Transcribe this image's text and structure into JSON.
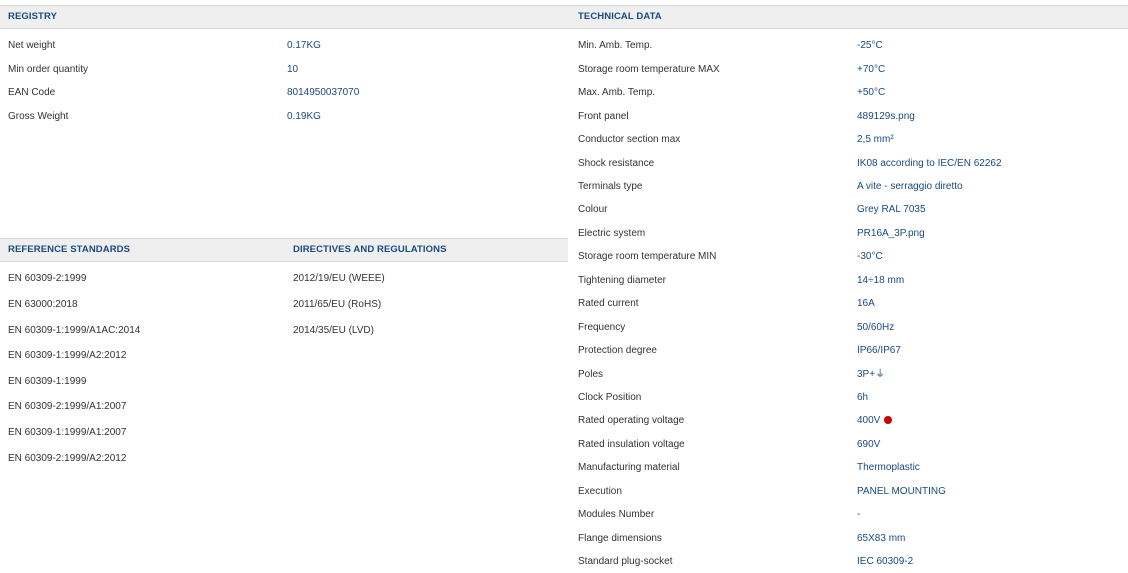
{
  "registry": {
    "title": "REGISTRY",
    "rows": [
      {
        "label": "Net weight",
        "value": "0.17KG"
      },
      {
        "label": "Min order quantity",
        "value": "10"
      },
      {
        "label": "EAN Code",
        "value": "8014950037070"
      },
      {
        "label": "Gross Weight",
        "value": "0.19KG"
      }
    ]
  },
  "reference_standards": {
    "title": "REFERENCE STANDARDS",
    "items": [
      "EN 60309-2:1999",
      "EN 63000:2018",
      "EN 60309-1:1999/A1AC:2014",
      "EN 60309-1:1999/A2:2012",
      "EN 60309-1:1999",
      "EN 60309-2:1999/A1:2007",
      "EN 60309-1:1999/A1:2007",
      "EN 60309-2:1999/A2:2012"
    ]
  },
  "directives": {
    "title": "DIRECTIVES AND REGULATIONS",
    "items": [
      "2012/19/EU (WEEE)",
      "2011/65/EU (RoHS)",
      "2014/35/EU (LVD)"
    ]
  },
  "technical_data": {
    "title": "TECHNICAL DATA",
    "rows": [
      {
        "label": "Min. Amb. Temp.",
        "value": "-25°C"
      },
      {
        "label": "Storage room temperature MAX",
        "value": "+70°C"
      },
      {
        "label": "Max. Amb. Temp.",
        "value": "+50°C"
      },
      {
        "label": "Front panel",
        "value": "489129s.png"
      },
      {
        "label": "Conductor section max",
        "value": "2,5 mm²"
      },
      {
        "label": "Shock resistance",
        "value": "IK08 according to IEC/EN 62262"
      },
      {
        "label": "Terminals type",
        "value": "A vite - serraggio diretto"
      },
      {
        "label": "Colour",
        "value": "Grey RAL 7035"
      },
      {
        "label": "Electric system",
        "value": "PR16A_3P.png"
      },
      {
        "label": "Storage room temperature MIN",
        "value": "-30°C"
      },
      {
        "label": "Tightening diameter",
        "value": "14÷18 mm"
      },
      {
        "label": "Rated current",
        "value": "16A"
      },
      {
        "label": "Frequency",
        "value": "50/60Hz"
      },
      {
        "label": "Protection degree",
        "value": "IP66/IP67"
      },
      {
        "label": "Poles",
        "value": "3P+⏚"
      },
      {
        "label": "Clock Position",
        "value": "6h"
      },
      {
        "label": "Rated operating voltage",
        "value": "400V",
        "dot_color": "#cc0000"
      },
      {
        "label": "Rated insulation voltage",
        "value": "690V"
      },
      {
        "label": "Manufacturing material",
        "value": "Thermoplastic"
      },
      {
        "label": "Execution",
        "value": "PANEL MOUNTING"
      },
      {
        "label": "Modules Number",
        "value": "-"
      },
      {
        "label": "Flange dimensions",
        "value": "65X83 mm"
      },
      {
        "label": "Standard plug-socket",
        "value": "IEC 60309-2"
      }
    ]
  }
}
